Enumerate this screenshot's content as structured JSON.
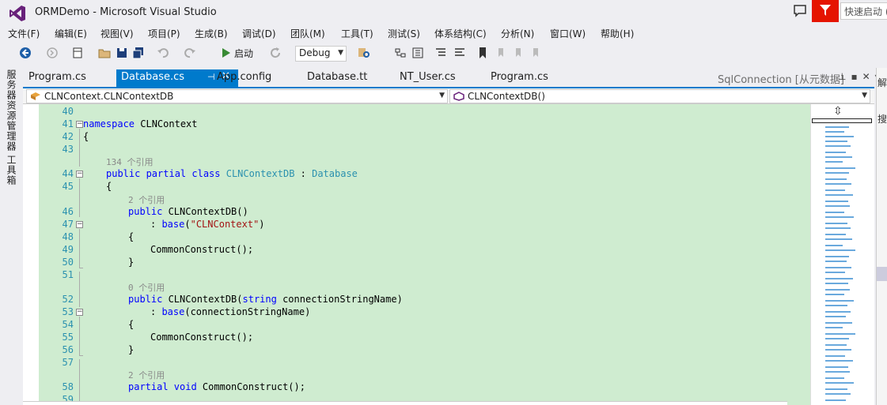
{
  "window": {
    "title": "ORMDemo - Microsoft Visual Studio",
    "quick_launch_placeholder": "快速启动 ("
  },
  "menu": [
    "文件(F)",
    "编辑(E)",
    "视图(V)",
    "项目(P)",
    "生成(B)",
    "调试(D)",
    "团队(M)",
    "工具(T)",
    "测试(S)",
    "体系结构(C)",
    "分析(N)",
    "窗口(W)",
    "帮助(H)"
  ],
  "toolbar": {
    "start_label": "启动",
    "config": "Debug"
  },
  "left_rail": {
    "server_explorer": "服务器资源管理器",
    "toolbox": "工具箱"
  },
  "tabs": [
    {
      "label": "Program.cs"
    },
    {
      "label": "Database.cs",
      "active": true
    },
    {
      "label": "App.config"
    },
    {
      "label": "Database.tt"
    },
    {
      "label": "NT_User.cs"
    },
    {
      "label": "Program.cs"
    }
  ],
  "preview_tab": "SqlConnection [从元数据]",
  "nav": {
    "type_scope": "CLNContext.CLNContextDB",
    "member_scope": "CLNContextDB()"
  },
  "code": {
    "l40": "40",
    "l41": "41",
    "l42": "42",
    "l43": "43",
    "l44": "44",
    "l45": "45",
    "l46": "46",
    "l47": "47",
    "l48": "48",
    "l49": "49",
    "l50": "50",
    "l51": "51",
    "l52": "52",
    "l53": "53",
    "l54": "54",
    "l55": "55",
    "l56": "56",
    "l57": "57",
    "l58": "58",
    "l59": "59",
    "ref134": "134 个引用",
    "ref2a": "2 个引用",
    "ref0": "0 个引用",
    "ref2b": "2 个引用",
    "kw_namespace": "namespace",
    "ns_name": " CLNContext",
    "brace_open": "{",
    "brace_close": "}",
    "kw_public_partial_class": "public partial class ",
    "class_name": "CLNContextDB",
    "colon": " : ",
    "base_type": "Database",
    "kw_public": "public ",
    "ctor": "CLNContextDB()",
    "colon2": ": ",
    "kw_base": "base",
    "paren_open": "(",
    "str_arg": "\"CLNContext\"",
    "paren_close": ")",
    "call_common": "CommonConstruct();",
    "ctor2_name": "CLNContextDB(",
    "kw_string": "string",
    "ctor2_param": " connectionStringName)",
    "base2_arg": "(connectionStringName)",
    "kw_partial_void": "partial void ",
    "partial_method": "CommonConstruct();"
  },
  "right_panel": {
    "t1": "解",
    "t2": "搜"
  }
}
